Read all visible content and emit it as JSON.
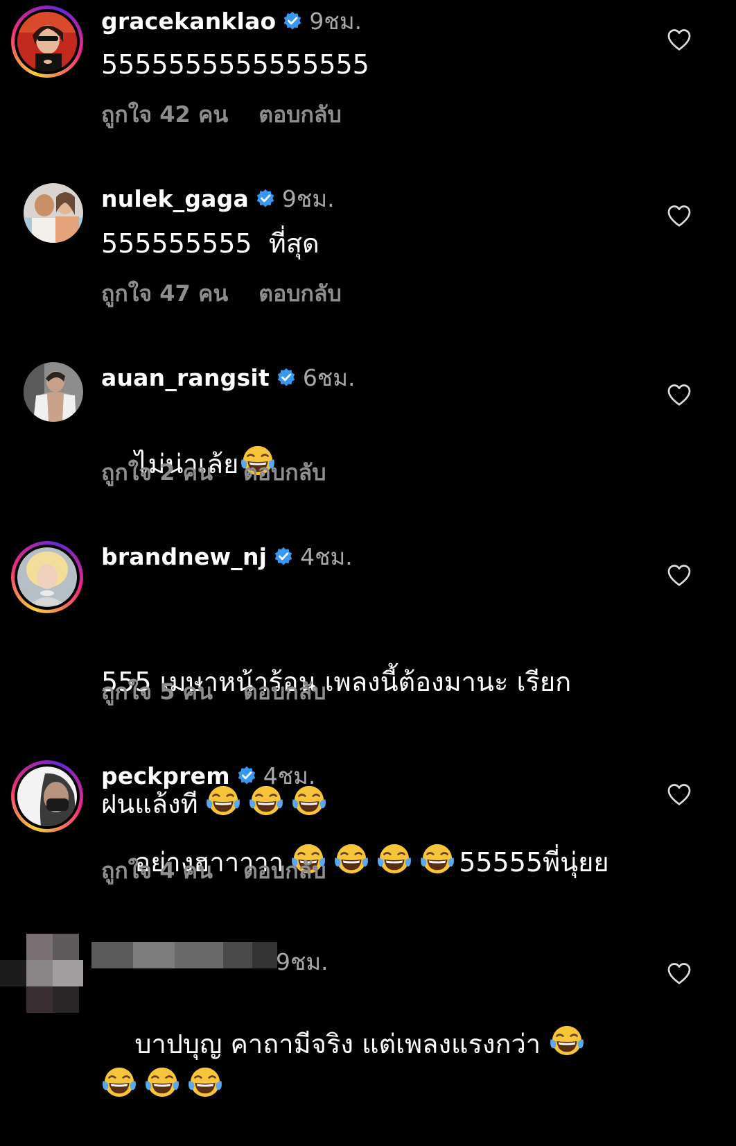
{
  "colors": {
    "background": "#000000",
    "primary_text": "#ffffff",
    "secondary_text": "#a8a8a8",
    "meta_text": "#8e8e8e",
    "verified_blue": "#3897f0"
  },
  "icons": {
    "verified": "verified-badge-icon",
    "like": "heart-outline-icon",
    "emoji": "face-with-tears-of-joy-emoji"
  },
  "comments": [
    {
      "username": "gracekanklao",
      "verified": true,
      "time": "9ชม.",
      "text": "5555555555555555",
      "likes": "ถูกใจ 42 คน",
      "reply": "ตอบกลับ"
    },
    {
      "username": "nulek_gaga",
      "verified": true,
      "time": "9ชม.",
      "text": "555555555  ที่สุด",
      "likes": "ถูกใจ 47 คน",
      "reply": "ตอบกลับ"
    },
    {
      "username": "auan_rangsit",
      "verified": true,
      "time": "6ชม.",
      "text": "ไม่น่าเล้ย",
      "likes": "ถูกใจ 2 คน",
      "reply": "ตอบกลับ"
    },
    {
      "username": "brandnew_nj",
      "verified": true,
      "time": "4ชม.",
      "text_line1": "555 เมษาหน้าร้อน เพลงนี้ต้องมานะ เรียก",
      "text_line2": "ฝนแล้งที",
      "likes": "ถูกใจ 5 คน",
      "reply": "ตอบกลับ"
    },
    {
      "username": "peckprem",
      "verified": true,
      "time": "4ชม.",
      "text_before": "อย่างฮาาาาา",
      "text_after": "55555พี่นุ่ยย",
      "likes": "ถูกใจ 4 คน",
      "reply": "ตอบกลับ"
    },
    {
      "time": "9ชม.",
      "text": "บาปบุญ คาถามีจริง แต่เพลงแรงกว่า"
    }
  ]
}
